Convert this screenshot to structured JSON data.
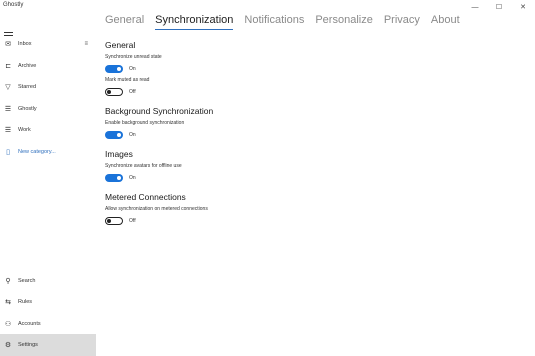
{
  "window": {
    "title": "Ghostly",
    "minimize": "—",
    "maximize": "☐",
    "close": "✕"
  },
  "sidebar": {
    "items": [
      {
        "icon": "inbox-icon",
        "glyph": "✉",
        "label": "Inbox",
        "sub": "≡"
      },
      {
        "icon": "archive-icon",
        "glyph": "⊏",
        "label": "Archive"
      },
      {
        "icon": "filter-icon",
        "glyph": "▽",
        "label": "Starred"
      },
      {
        "icon": "list-icon",
        "glyph": "☰",
        "label": "Ghostly"
      },
      {
        "icon": "list-icon",
        "glyph": "☰",
        "label": "Work"
      },
      {
        "icon": "new-category-icon",
        "glyph": "▯",
        "label": "New category..."
      }
    ],
    "bottom": [
      {
        "icon": "search-icon",
        "glyph": "⚲",
        "label": "Search"
      },
      {
        "icon": "rules-icon",
        "glyph": "⇆",
        "label": "Rules"
      },
      {
        "icon": "accounts-icon",
        "glyph": "⚇",
        "label": "Accounts"
      },
      {
        "icon": "settings-icon",
        "glyph": "⚙",
        "label": "Settings"
      }
    ]
  },
  "tabs": [
    "General",
    "Synchronization",
    "Notifications",
    "Personalize",
    "Privacy",
    "About"
  ],
  "active_tab": "Synchronization",
  "sections": {
    "general": {
      "title": "General",
      "sync_unread_label": "Synchronize unread state",
      "sync_unread_state": "On",
      "mark_muted_label": "Mark muted as read",
      "mark_muted_state": "Off"
    },
    "background": {
      "title": "Background Synchronization",
      "enable_label": "Enable background synchronization",
      "enable_state": "On"
    },
    "images": {
      "title": "Images",
      "avatars_label": "Synchronize avatars for offline use",
      "avatars_state": "On"
    },
    "metered": {
      "title": "Metered Connections",
      "allow_label": "Allow synchronization on metered connections",
      "allow_state": "Off"
    }
  },
  "colors": {
    "accent": "#1a73d9",
    "selected_bg": "#dcdcdc"
  }
}
